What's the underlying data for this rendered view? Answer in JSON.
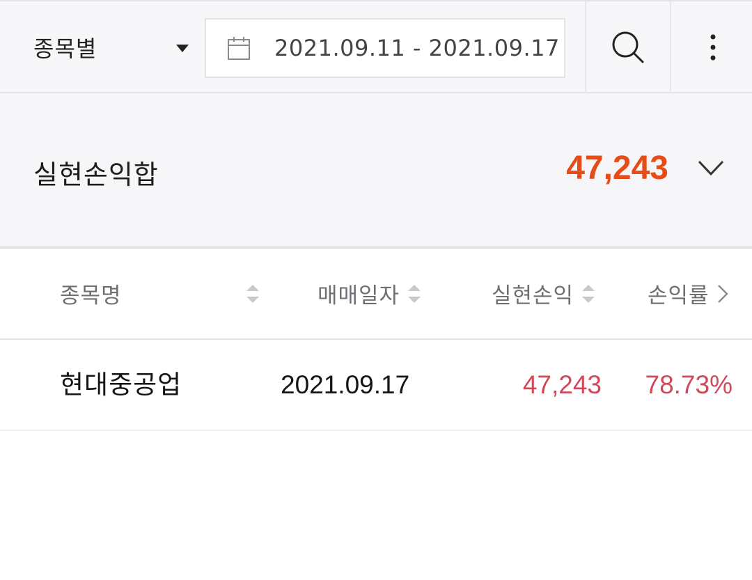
{
  "filter": {
    "group_by": "종목별",
    "date_range": "2021.09.11 - 2021.09.17"
  },
  "summary": {
    "title": "실현손익합",
    "total": "47,243"
  },
  "table": {
    "columns": [
      "종목명",
      "매매일자",
      "실현손익",
      "손익률"
    ],
    "rows": [
      {
        "name": "현대중공업",
        "date": "2021.09.17",
        "profit": "47,243",
        "rate": "78.73%"
      }
    ]
  },
  "colors": {
    "total": "#e64c18",
    "profit": "#d0485a"
  },
  "icons": [
    "caret-down-icon",
    "calendar-icon",
    "search-icon",
    "more-vertical-icon",
    "chevron-down-icon",
    "sort-icon",
    "chevron-right-icon"
  ]
}
